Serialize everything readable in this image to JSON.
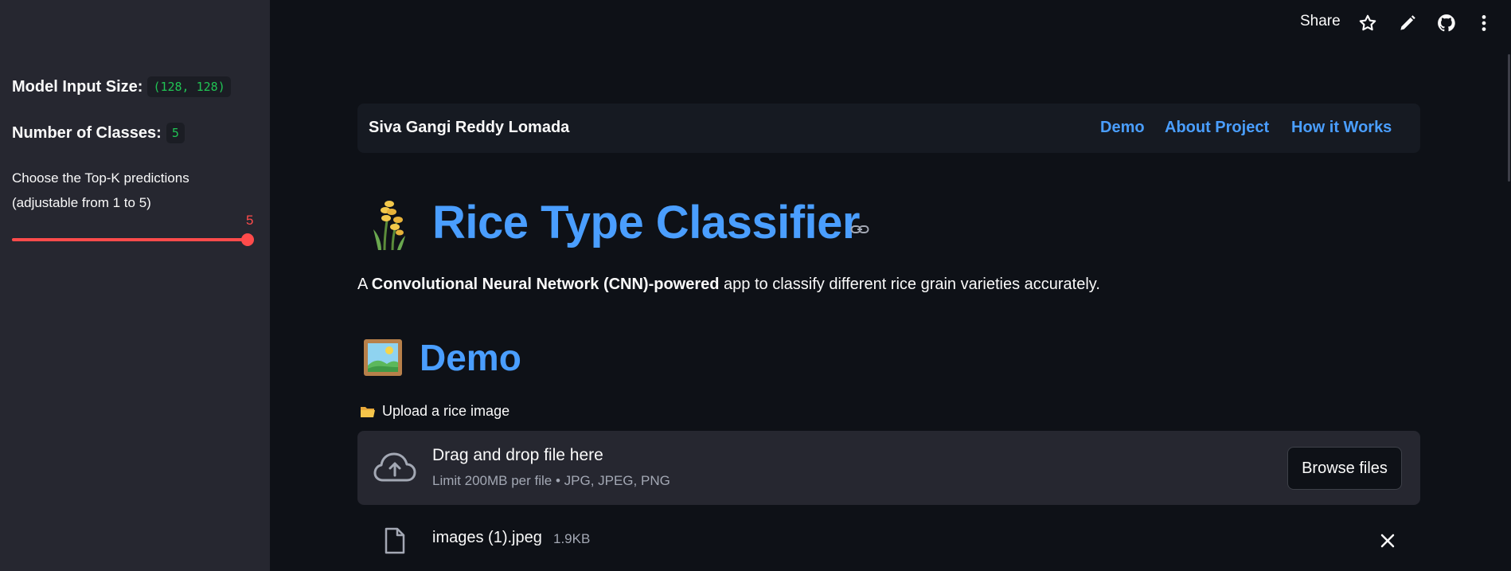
{
  "sidebar": {
    "model_input_label": "Model Input Size:",
    "model_input_value": "(128, 128)",
    "num_classes_label": "Number of Classes:",
    "num_classes_value": "5",
    "slider_label_line1": "Choose the Top-K predictions",
    "slider_label_line2": "(adjustable from 1 to 5)",
    "slider_value": "5",
    "slider_min": 1,
    "slider_max": 5,
    "slider_fraction": 1.0
  },
  "toolbar": {
    "share_label": "Share",
    "icons": [
      "star-icon",
      "pencil-icon",
      "github-icon",
      "more-vert-icon"
    ]
  },
  "nav": {
    "author": "Siva Gangi Reddy Lomada",
    "links": [
      "Demo",
      "About Project",
      "How it Works"
    ]
  },
  "main": {
    "title": "Rice Type Classifier",
    "description_prefix": "A ",
    "description_bold": "Convolutional Neural Network (CNN)-powered",
    "description_suffix": " app to classify different rice grain varieties accurately.",
    "demo_heading": "Demo"
  },
  "uploader": {
    "label": "Upload a rice image",
    "drop_title": "Drag and drop file here",
    "drop_sub": "Limit 200MB per file • JPG, JPEG, PNG",
    "browse_label": "Browse files"
  },
  "file": {
    "name": "images (1).jpeg",
    "size": "1.9KB"
  },
  "colors": {
    "background": "#0e1117",
    "sidebar": "#262730",
    "accent_blue": "#4a9eff",
    "slider_red": "#ff4b4b",
    "code_green": "#21c354"
  }
}
